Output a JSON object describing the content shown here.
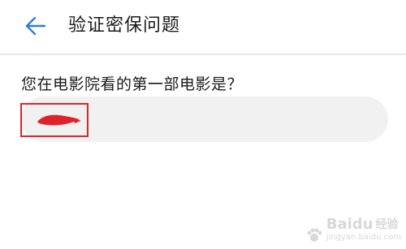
{
  "header": {
    "back_icon": "arrow-left-icon",
    "title": "验证密保问题"
  },
  "main": {
    "question": "您在电影院看的第一部电影是？",
    "answer_value": ""
  },
  "colors": {
    "accent": "#2f7fd6",
    "redaction": "#e0232a",
    "field_background": "#f1f1f1"
  },
  "watermark": {
    "logo_text": "Baidu",
    "sub_text": "经验",
    "url": "jingyan.baidu.com"
  }
}
